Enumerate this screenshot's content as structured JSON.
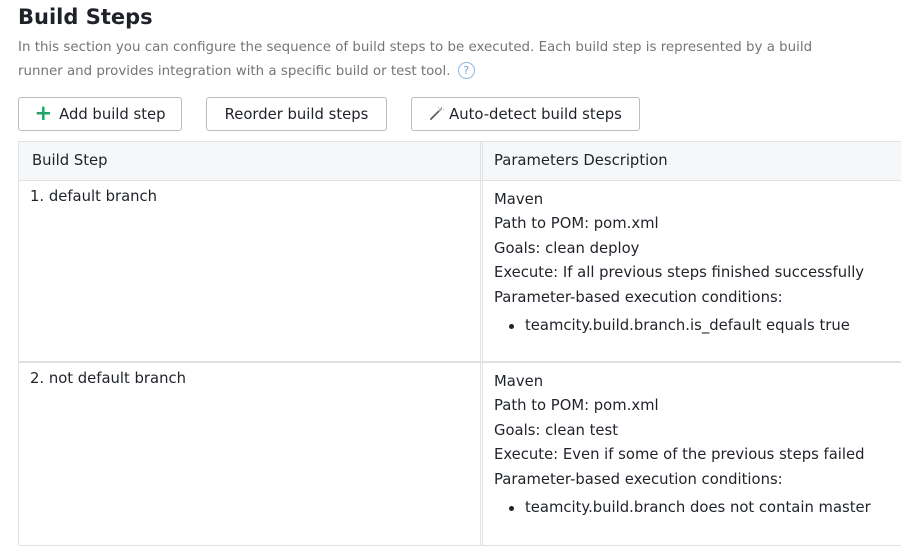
{
  "header": {
    "title": "Build Steps",
    "description": "In this section you can configure the sequence of build steps to be executed. Each build step is represented by a build runner and provides integration with a specific build or test tool.",
    "help_glyph": "?"
  },
  "toolbar": {
    "add_icon": "plus-icon",
    "add_label": "Add build step",
    "reorder_label": "Reorder build steps",
    "auto_icon": "magic-wand-icon",
    "auto_label": "Auto-detect build steps"
  },
  "table": {
    "columns": [
      "Build Step",
      "Parameters Description"
    ],
    "rows": [
      {
        "name": "1. default branch",
        "runner": "Maven",
        "pom": "Path to POM: pom.xml",
        "goals": "Goals: clean deploy",
        "execute": "Execute: If all previous steps finished successfully",
        "conditions_label": "Parameter-based execution conditions:",
        "conditions": [
          "teamcity.build.branch.is_default equals true"
        ]
      },
      {
        "name": "2. not default branch",
        "runner": "Maven",
        "pom": "Path to POM: pom.xml",
        "goals": "Goals: clean test",
        "execute": "Execute: Even if some of the previous steps failed",
        "conditions_label": "Parameter-based execution conditions:",
        "conditions": [
          "teamcity.build.branch does not contain master"
        ]
      }
    ]
  },
  "colors": {
    "accent_green": "#21a366",
    "help_blue": "#6f9fd6",
    "border": "#e0e1e3",
    "header_bg": "#f6f7f8"
  }
}
